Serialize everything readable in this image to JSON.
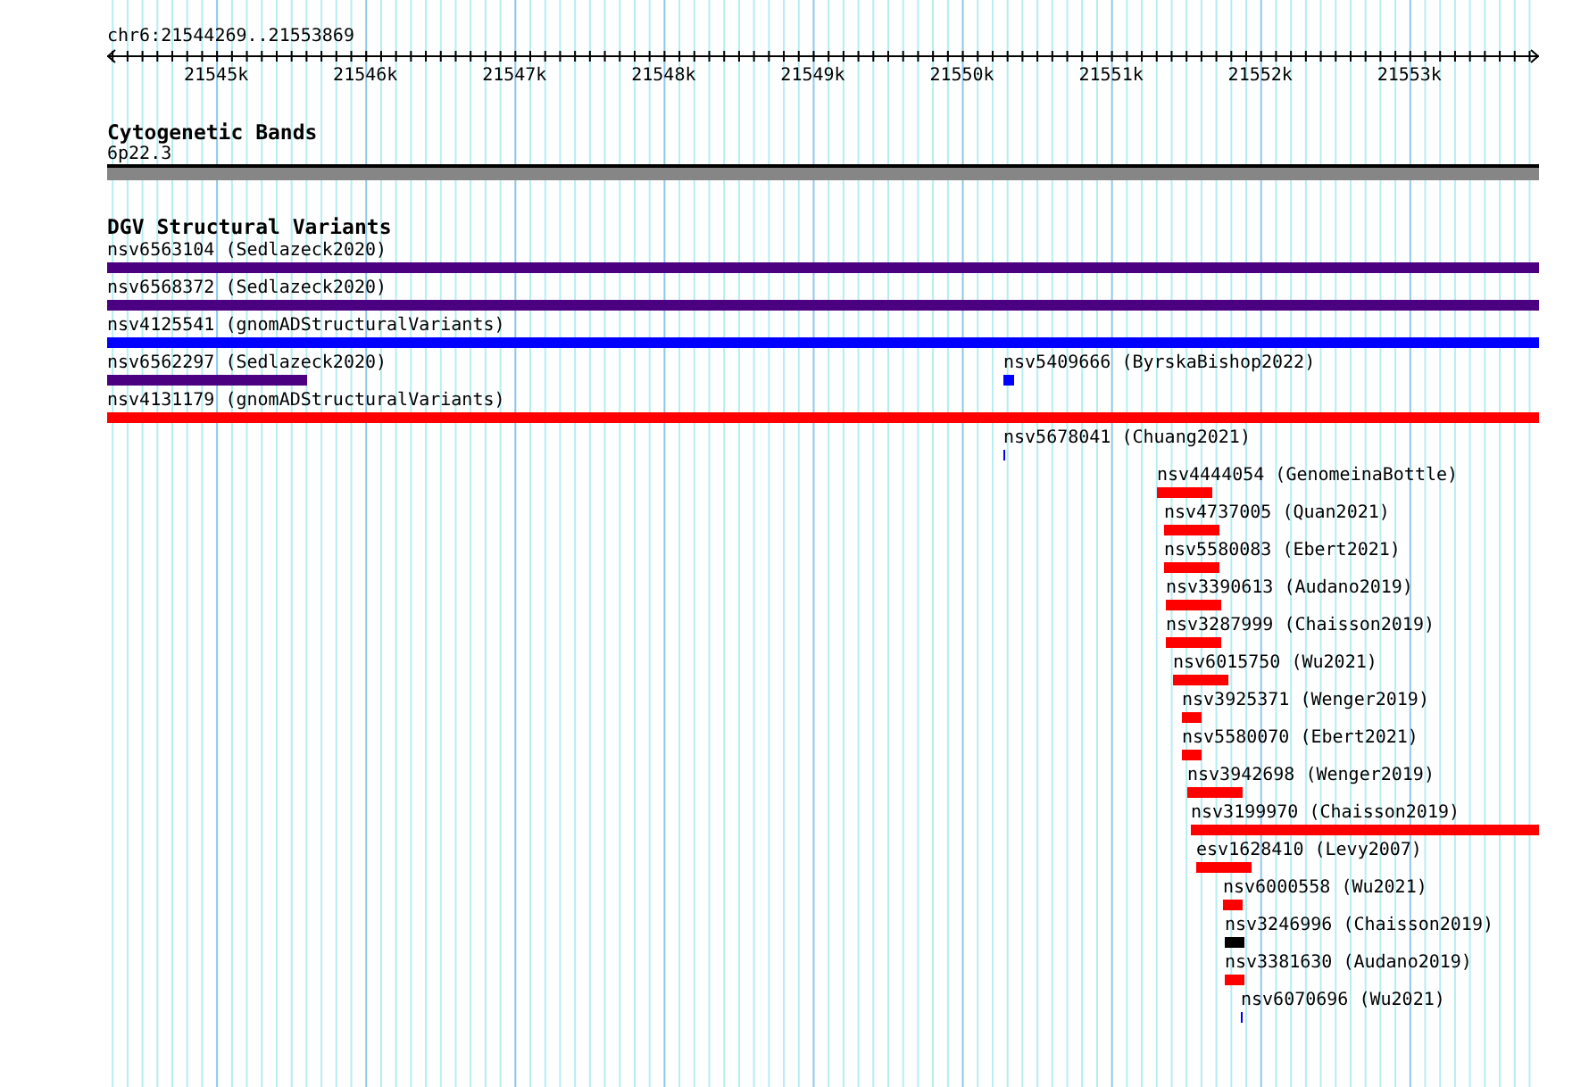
{
  "location": "chr6:21544269..21553869",
  "ruler": {
    "ticks": [
      "21545k",
      "21546k",
      "21547k",
      "21548k",
      "21549k",
      "21550k",
      "21551k",
      "21552k",
      "21553k"
    ]
  },
  "cytogenetic_bands": {
    "title": "Cytogenetic Bands",
    "band": "6p22.3"
  },
  "dgv_structural_variants": {
    "title": "DGV Structural Variants",
    "rows": [
      {
        "features": [
          {
            "label": "nsv6563104 (Sedlazeck2020)",
            "color": "#4b0082"
          }
        ]
      },
      {
        "features": [
          {
            "label": "nsv6568372 (Sedlazeck2020)",
            "color": "#4b0082"
          }
        ]
      },
      {
        "features": [
          {
            "label": "nsv4125541 (gnomADStructuralVariants)",
            "color": "#0000ff"
          }
        ]
      },
      {
        "features": [
          {
            "label": "nsv6562297 (Sedlazeck2020)",
            "color": "#4b0082"
          },
          {
            "label": "nsv5409666 (ByrskaBishop2022)",
            "color": "#0000ff"
          }
        ]
      },
      {
        "features": [
          {
            "label": "nsv4131179 (gnomADStructuralVariants)",
            "color": "#ff0000"
          }
        ]
      },
      {
        "features": [
          {
            "label": "nsv5678041 (Chuang2021)",
            "color": "#0000ff"
          }
        ]
      },
      {
        "features": [
          {
            "label": "nsv4444054 (GenomeinaBottle)",
            "color": "#ff0000"
          }
        ]
      },
      {
        "features": [
          {
            "label": "nsv4737005 (Quan2021)",
            "color": "#ff0000"
          }
        ]
      },
      {
        "features": [
          {
            "label": "nsv5580083 (Ebert2021)",
            "color": "#ff0000"
          }
        ]
      },
      {
        "features": [
          {
            "label": "nsv3390613 (Audano2019)",
            "color": "#ff0000"
          }
        ]
      },
      {
        "features": [
          {
            "label": "nsv3287999 (Chaisson2019)",
            "color": "#ff0000"
          }
        ]
      },
      {
        "features": [
          {
            "label": "nsv6015750 (Wu2021)",
            "color": "#ff0000"
          }
        ]
      },
      {
        "features": [
          {
            "label": "nsv3925371 (Wenger2019)",
            "color": "#ff0000"
          }
        ]
      },
      {
        "features": [
          {
            "label": "nsv5580070 (Ebert2021)",
            "color": "#ff0000"
          }
        ]
      },
      {
        "features": [
          {
            "label": "nsv3942698 (Wenger2019)",
            "color": "#ff0000"
          }
        ]
      },
      {
        "features": [
          {
            "label": "nsv3199970 (Chaisson2019)",
            "color": "#ff0000"
          }
        ]
      },
      {
        "features": [
          {
            "label": "esv1628410 (Levy2007)",
            "color": "#ff0000"
          }
        ]
      },
      {
        "features": [
          {
            "label": "nsv6000558 (Wu2021)",
            "color": "#ff0000"
          }
        ]
      },
      {
        "features": [
          {
            "label": "nsv3246996 (Chaisson2019)",
            "color": "#000000"
          }
        ]
      },
      {
        "features": [
          {
            "label": "nsv3381630 (Audano2019)",
            "color": "#ff0000"
          }
        ]
      },
      {
        "features": [
          {
            "label": "nsv6070696 (Wu2021)",
            "color": "#0000ff"
          }
        ]
      }
    ]
  }
}
